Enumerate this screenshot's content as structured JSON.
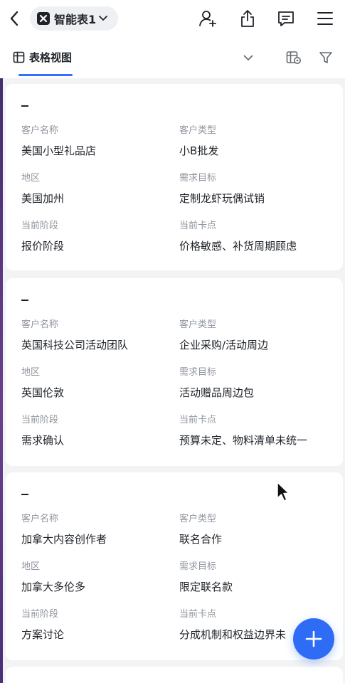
{
  "header": {
    "doc_title": "智能表1",
    "icons": [
      "back-icon",
      "sheet-logo-icon",
      "chevron-down-icon",
      "add-person-icon",
      "share-icon",
      "comment-icon",
      "menu-icon"
    ]
  },
  "view": {
    "active_tab": "表格视图",
    "icons": [
      "table-icon",
      "dropdown-icon",
      "settings-icon",
      "filter-icon"
    ]
  },
  "colors": {
    "accent": "#3370ff",
    "fab": "#2f6cf6"
  },
  "cards": [
    {
      "title": "–",
      "fields": [
        {
          "label": "客户名称",
          "value": "美国小型礼品店"
        },
        {
          "label": "客户类型",
          "value": "小B批发"
        },
        {
          "label": "地区",
          "value": "美国加州"
        },
        {
          "label": "需求目标",
          "value": "定制龙虾玩偶试销"
        },
        {
          "label": "当前阶段",
          "value": "报价阶段"
        },
        {
          "label": "当前卡点",
          "value": "价格敏感、补货周期顾虑"
        }
      ]
    },
    {
      "title": "–",
      "fields": [
        {
          "label": "客户名称",
          "value": "英国科技公司活动团队"
        },
        {
          "label": "客户类型",
          "value": "企业采购/活动周边"
        },
        {
          "label": "地区",
          "value": "英国伦敦"
        },
        {
          "label": "需求目标",
          "value": "活动赠品周边包"
        },
        {
          "label": "当前阶段",
          "value": "需求确认"
        },
        {
          "label": "当前卡点",
          "value": "预算未定、物料清单未统一"
        }
      ]
    },
    {
      "title": "–",
      "fields": [
        {
          "label": "客户名称",
          "value": "加拿大内容创作者"
        },
        {
          "label": "客户类型",
          "value": "联名合作"
        },
        {
          "label": "地区",
          "value": "加拿大多伦多"
        },
        {
          "label": "需求目标",
          "value": "限定联名款"
        },
        {
          "label": "当前阶段",
          "value": "方案讨论"
        },
        {
          "label": "当前卡点",
          "value": "分成机制和权益边界未"
        }
      ]
    }
  ],
  "fab": {
    "icon": "plus-icon"
  }
}
